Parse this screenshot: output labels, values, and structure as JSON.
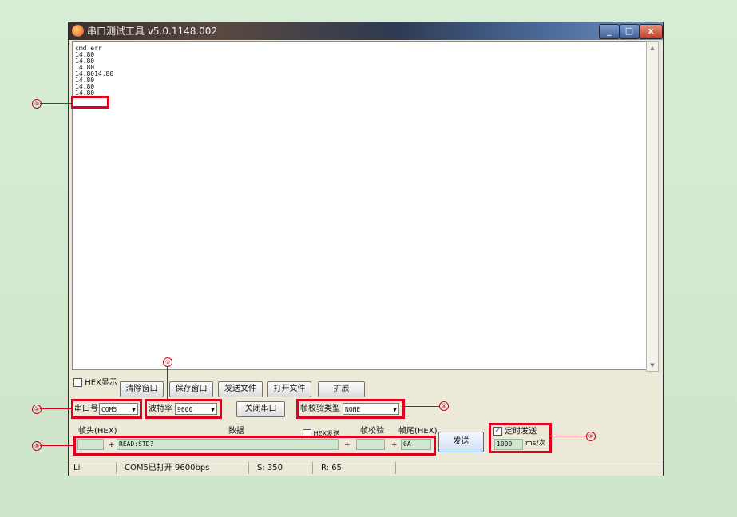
{
  "window": {
    "title": "串口测试工具 v5.0.1148.002",
    "minimize": "_",
    "maximize": "□",
    "close": "x"
  },
  "output": {
    "lines": [
      "cmd err",
      "14.80",
      "14.80",
      "14.80",
      "14.8014.80",
      "14.80",
      "14.80",
      "14.80"
    ]
  },
  "controls": {
    "hex_display_label": "HEX显示",
    "clear_window": "清除窗口",
    "save_window": "保存窗口",
    "send_file": "发送文件",
    "open_file": "打开文件",
    "expand": "扩展",
    "port_label": "串口号",
    "port_value": "COM5",
    "baud_label": "波特率",
    "baud_value": "9600",
    "close_port": "关闭串口",
    "checksum_label": "帧校验类型",
    "checksum_value": "NONE"
  },
  "send": {
    "header_label": "帧头(HEX)",
    "data_label": "数据",
    "hex_send_label": "HEX发送",
    "frame_check_label": "帧校验",
    "tail_label": "帧尾(HEX)",
    "data_value": "READ:STD?",
    "tail_value": "0A",
    "plus": "+",
    "send_button": "发送",
    "timed_send_label": "定时发送",
    "interval_value": "1000",
    "interval_unit": "ms/次"
  },
  "status": {
    "left": "Li",
    "port_status": "COM5已打开 9600bps",
    "sent": "S: 350",
    "received": "R: 65"
  },
  "annotations": {
    "m1": "①",
    "m2": "②",
    "m3": "③",
    "m4": "④",
    "m5": "⑤",
    "m6": "⑥"
  },
  "colors": {
    "highlight": "#e0001e",
    "page_background": "#cfe6cf"
  }
}
